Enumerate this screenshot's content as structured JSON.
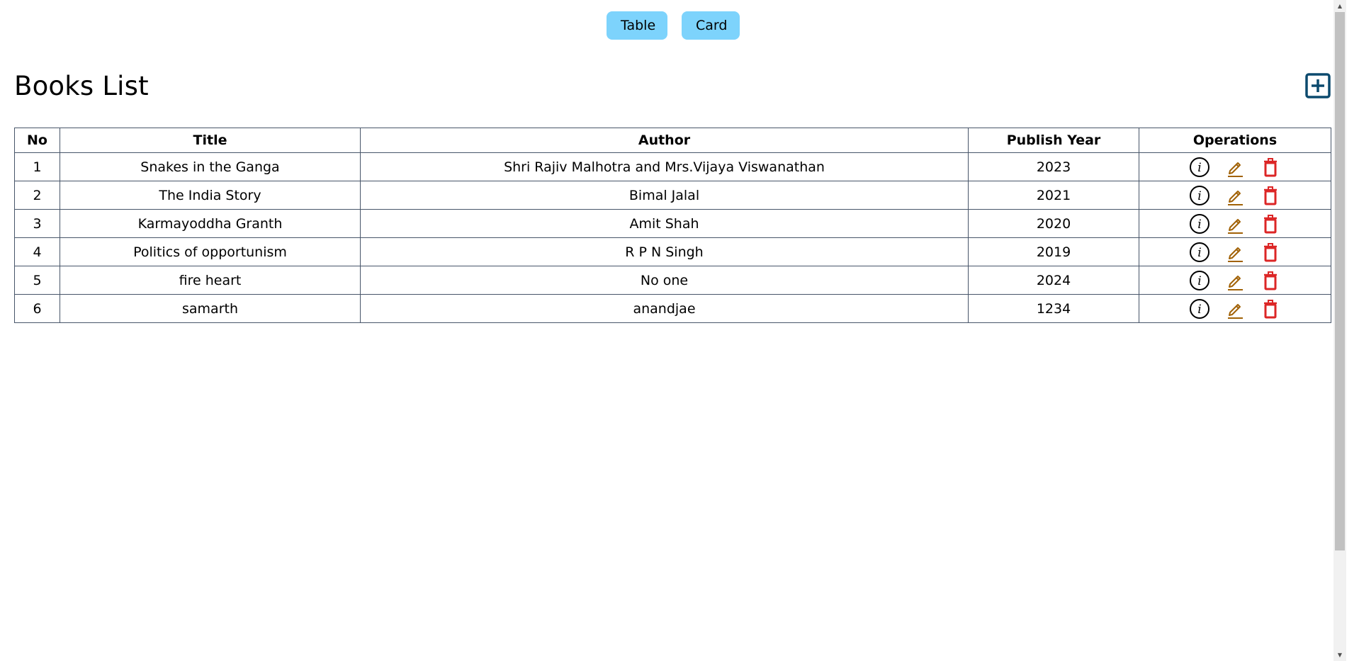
{
  "view_toggle": {
    "table_label": "Table",
    "card_label": "Card"
  },
  "header": {
    "title": "Books List",
    "add_icon": "plus-square-icon"
  },
  "table": {
    "columns": [
      "No",
      "Title",
      "Author",
      "Publish Year",
      "Operations"
    ],
    "rows": [
      {
        "no": "1",
        "title": "Snakes in the Ganga",
        "author": "Shri Rajiv Malhotra and Mrs.Vijaya Viswanathan",
        "year": "2023"
      },
      {
        "no": "2",
        "title": "The India Story",
        "author": "Bimal Jalal",
        "year": "2021"
      },
      {
        "no": "3",
        "title": "Karmayoddha Granth",
        "author": "Amit Shah",
        "year": "2020"
      },
      {
        "no": "4",
        "title": "Politics of opportunism",
        "author": "R P N Singh",
        "year": "2019"
      },
      {
        "no": "5",
        "title": "fire heart",
        "author": "No one",
        "year": "2024"
      },
      {
        "no": "6",
        "title": "samarth",
        "author": "anandjae",
        "year": "1234"
      }
    ],
    "operation_icons": [
      "info-icon",
      "edit-icon",
      "delete-icon"
    ]
  },
  "colors": {
    "toggle_bg": "#7dd3fc",
    "add_icon": "#0c4a6e",
    "info_icon": "#000000",
    "edit_icon": "#a16207",
    "delete_icon": "#dc2626",
    "table_border": "#475569"
  }
}
